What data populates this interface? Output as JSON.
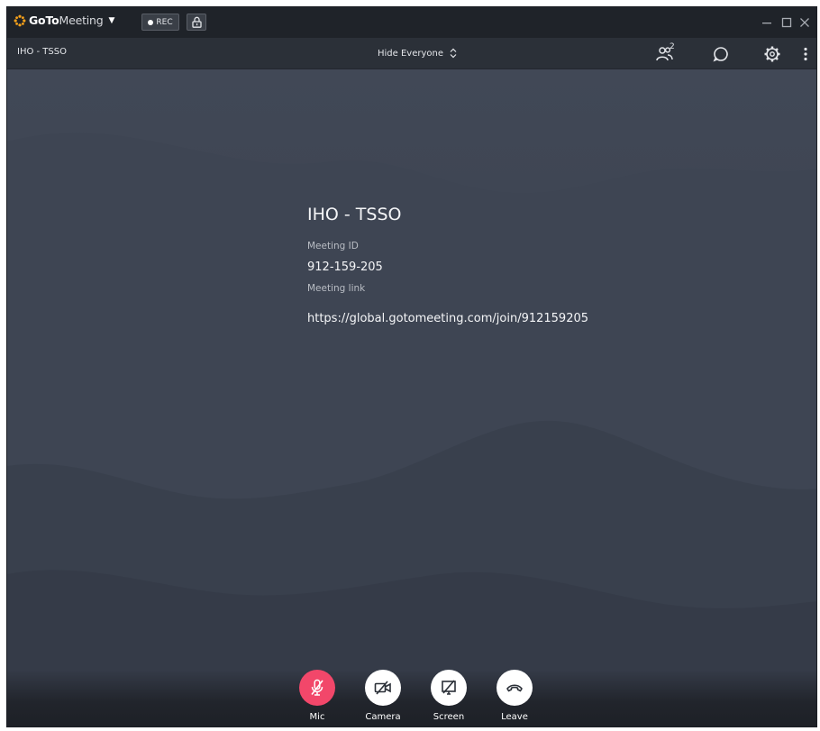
{
  "titlebar": {
    "brand_bold": "GoTo",
    "brand_light": "Meeting",
    "rec_label": "REC",
    "window_controls": [
      "minimize",
      "maximize",
      "close"
    ]
  },
  "toolbar": {
    "meeting_name": "IHO - TSSO",
    "view_mode": "Hide Everyone",
    "attendee_count": "2",
    "icons": [
      "attendees-icon",
      "chat-icon",
      "settings-icon",
      "more-icon"
    ]
  },
  "meeting": {
    "title": "IHO - TSSO",
    "id_label": "Meeting ID",
    "id_value": "912-159-205",
    "link_label": "Meeting link",
    "link_value": "https://global.gotomeeting.com/join/912159205"
  },
  "controls": [
    {
      "label": "Mic",
      "icon": "mic-off-icon",
      "state": "muted"
    },
    {
      "label": "Camera",
      "icon": "camera-off-icon",
      "state": "off"
    },
    {
      "label": "Screen",
      "icon": "screen-share-icon",
      "state": "off"
    },
    {
      "label": "Leave",
      "icon": "hang-up-icon",
      "state": "idle"
    }
  ],
  "colors": {
    "accent_orange": "#f7a21b",
    "mic_muted_red": "#f2476a",
    "stage_bg": "#3a4150",
    "titlebar_bg": "#1f2329"
  }
}
